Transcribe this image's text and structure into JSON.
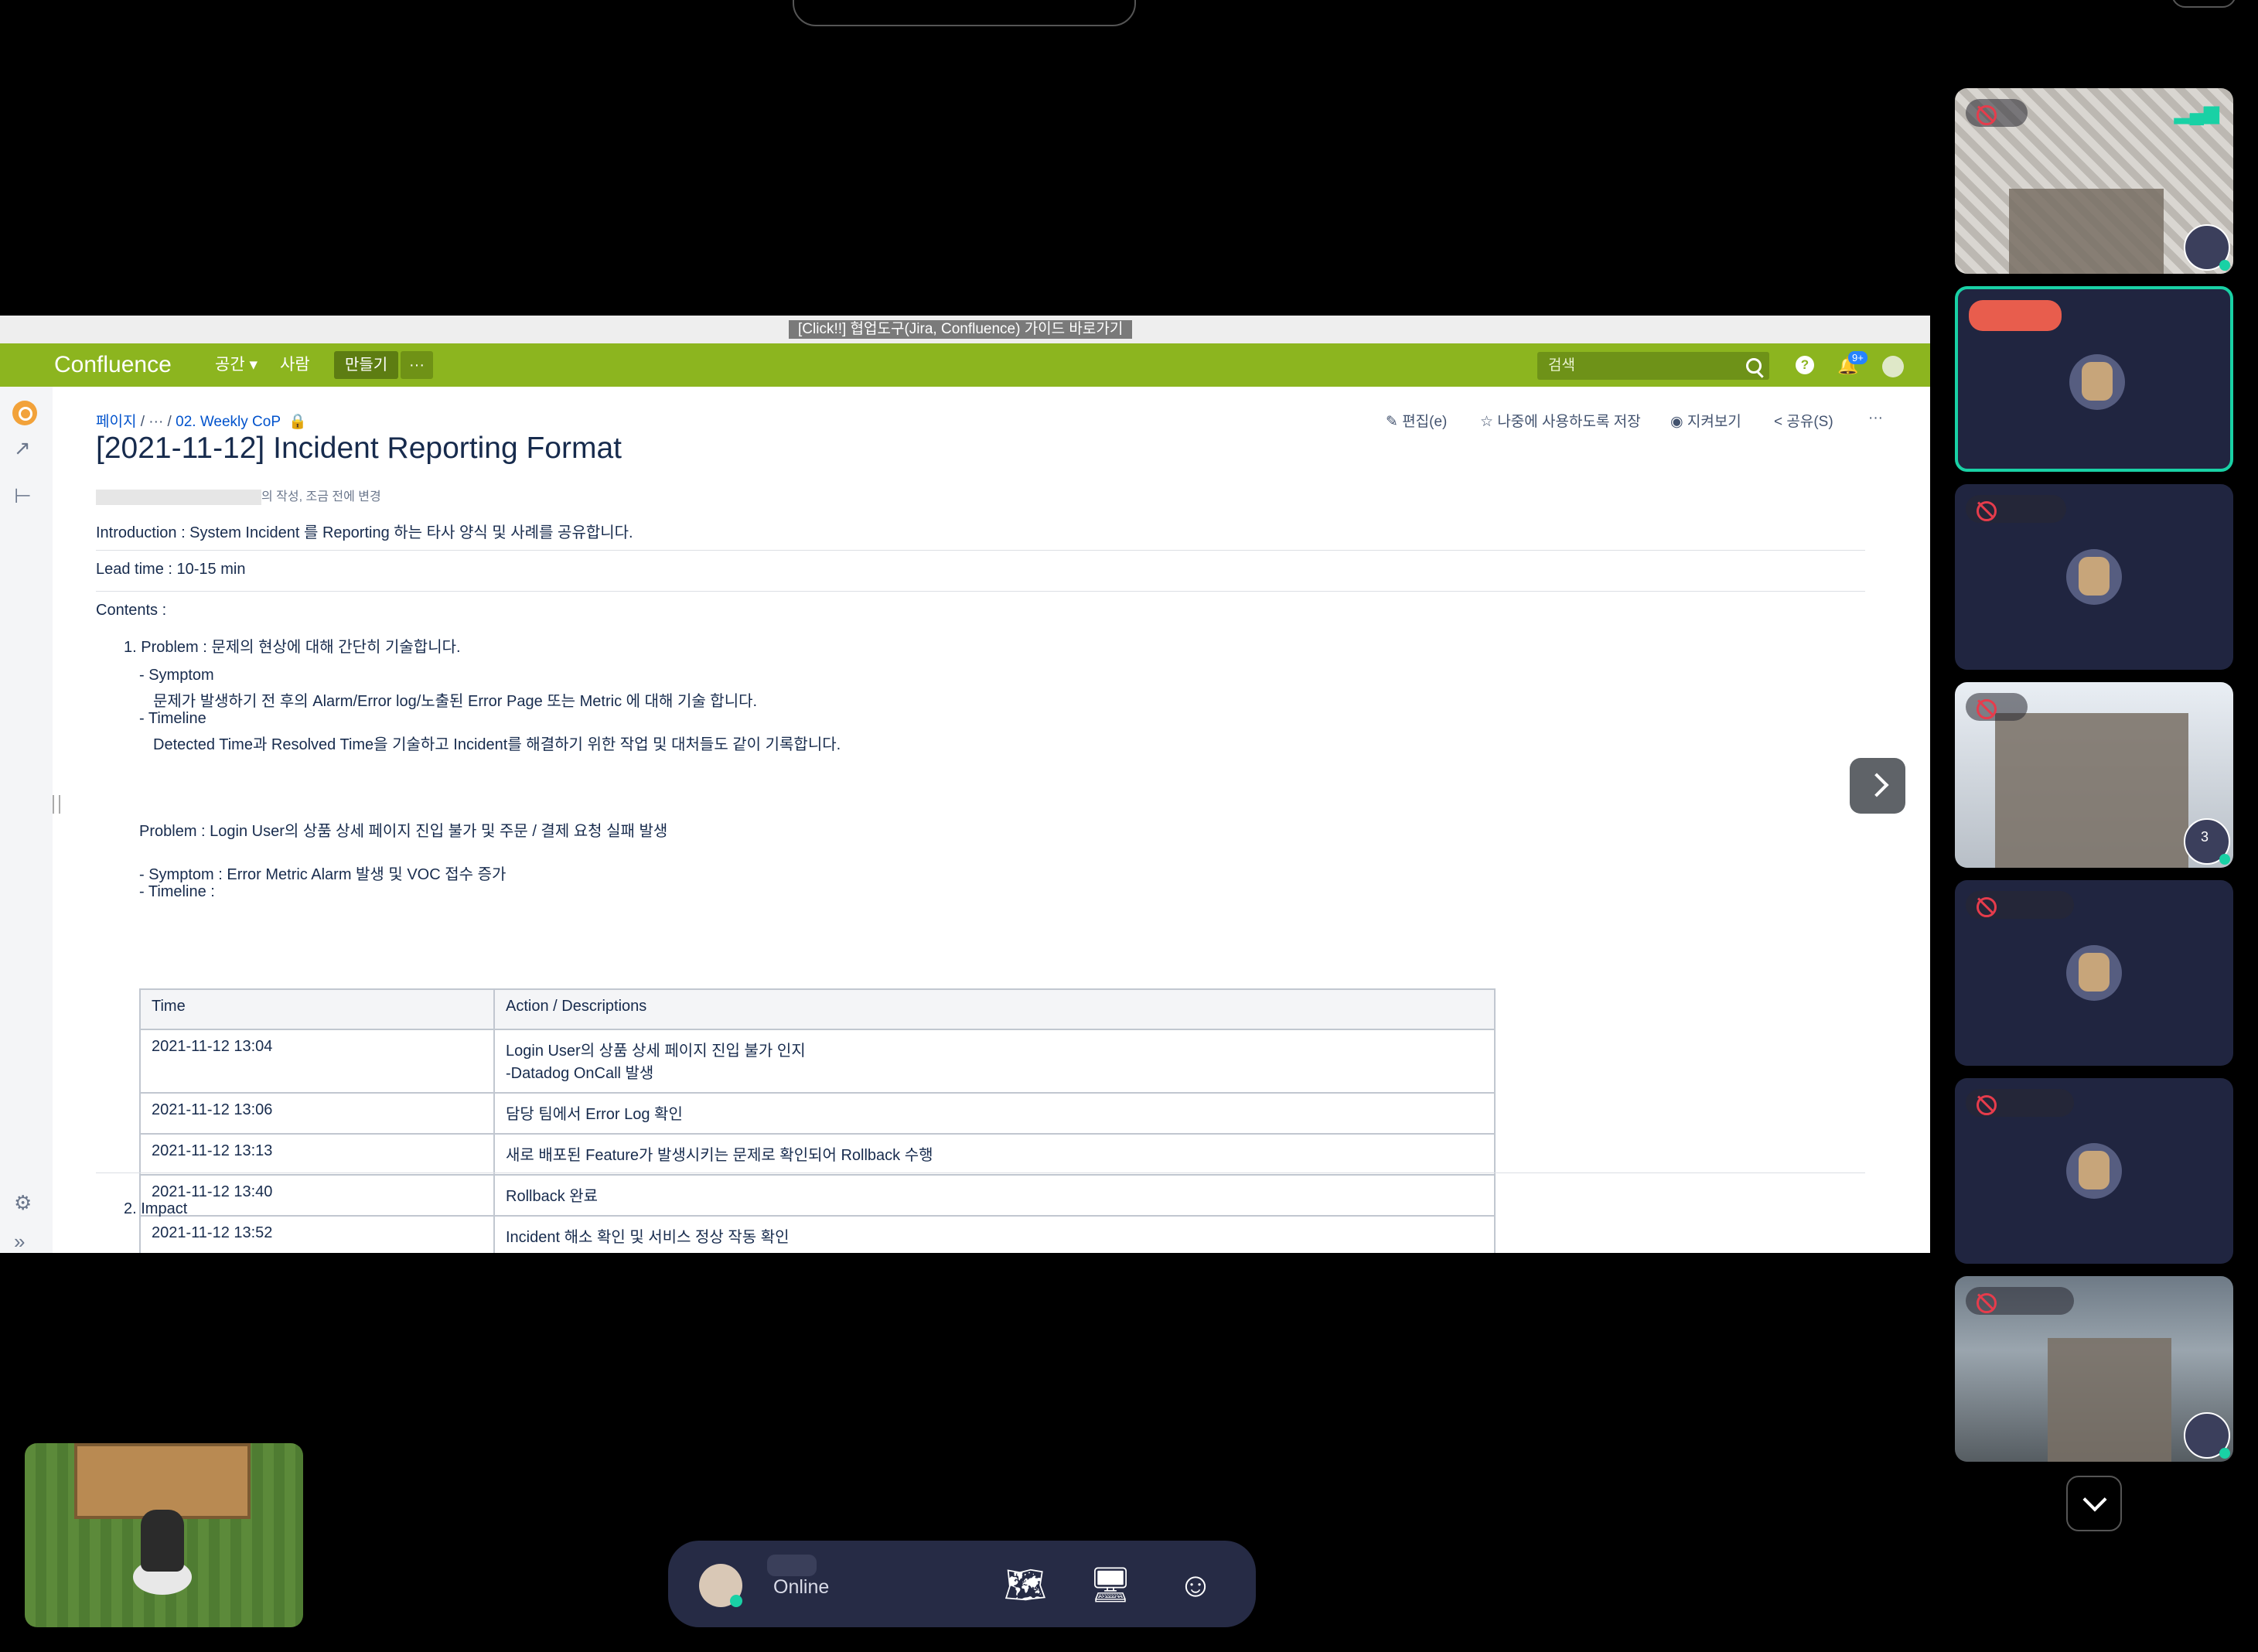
{
  "confluence": {
    "banner": "[Click!!] 협업도구(Jira, Confluence) 가이드 바로가기",
    "nav": {
      "logo": "Confluence",
      "spaces": "공간",
      "people": "사람",
      "create": "만들기",
      "more": "···",
      "search_placeholder": "검색",
      "notifications_badge": "9+"
    },
    "breadcrumb": {
      "pages": "페이지",
      "ellipsis": "···",
      "parent": "02. Weekly CoP"
    },
    "actions": {
      "edit": "편집(e)",
      "save_later": "나중에 사용하도록 저장",
      "watch": "지켜보기",
      "share": "공유(S)",
      "more": "···"
    },
    "page": {
      "title": "[2021-11-12] Incident Reporting Format",
      "meta": "의 작성, 조금 전에 변경",
      "introduction": "Introduction :  System Incident 를 Reporting 하는 타사 양식 및 사례를 공유합니다.",
      "lead_time": "Lead time : 10-15 min",
      "contents_label": "Contents :",
      "item1": "1. Problem : 문제의 현상에 대해 간단히 기술합니다.",
      "symptom_label": "- Symptom",
      "symptom_desc": "문제가 발생하기 전 후의 Alarm/Error log/노출된 Error Page 또는 Metric 에 대해 기술 합니다.",
      "timeline_label": "- Timeline",
      "timeline_desc": "Detected Time과 Resolved Time을 기술하고 Incident를 해결하기 위한 작업 및 대처들도 같이 기록합니다.",
      "example_problem": "Problem : Login User의 상품 상세 페이지 진입 불가 및 주문 / 결제 요청 실패 발생",
      "example_symptom": "- Symptom : Error Metric Alarm 발생 및 VOC 접수 증가",
      "example_timeline": "- Timeline :",
      "item2": "2. Impact"
    },
    "timeline_table": {
      "headers": [
        "Time",
        "Action / Descriptions"
      ],
      "rows": [
        {
          "time": "2021-11-12 13:04",
          "action": "Login User의 상품 상세 페이지 진입 불가 인지",
          "action2": "-Datadog OnCall 발생"
        },
        {
          "time": "2021-11-12 13:06",
          "action": "담당 팀에서 Error Log 확인"
        },
        {
          "time": "2021-11-12 13:13",
          "action": "새로 배포된 Feature가 발생시키는 문제로 확인되어 Rollback 수행"
        },
        {
          "time": "2021-11-12 13:40",
          "action": "Rollback 완료"
        },
        {
          "time": "2021-11-12 13:52",
          "action": "Incident 해소 확인 및 서비스 정상 작동 확인"
        }
      ]
    }
  },
  "participants": {
    "tile4_badge": "3"
  },
  "bottombar": {
    "status": "Online"
  },
  "icons": [
    "map-icon",
    "screen-share-icon",
    "emoji-icon",
    "chevron-right-icon",
    "chevron-down-icon",
    "mic-muted-icon",
    "search-icon",
    "help-icon",
    "bell-icon"
  ],
  "colors": {
    "confluence_green": "#8cb51f",
    "active_speaker": "#19d1a5",
    "muted_red": "#e63c4c"
  }
}
